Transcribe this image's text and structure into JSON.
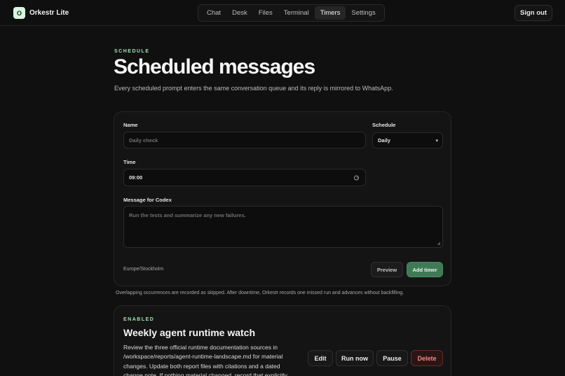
{
  "brand": {
    "mark": "O",
    "name": "Orkestr Lite"
  },
  "nav": {
    "items": [
      "Chat",
      "Desk",
      "Files",
      "Terminal",
      "Timers",
      "Settings"
    ],
    "active": "Timers"
  },
  "header": {
    "signout_label": "Sign out"
  },
  "hero": {
    "eyebrow": "SCHEDULE",
    "title": "Scheduled messages",
    "subtitle": "Every scheduled prompt enters the same conversation queue and its reply is mirrored to WhatsApp."
  },
  "form": {
    "name_label": "Name",
    "name_placeholder": "Daily check",
    "schedule_label": "Schedule",
    "schedule_value": "Daily",
    "time_label": "Time",
    "time_value": "09:00",
    "message_label": "Message for Codex",
    "message_placeholder": "Run the tests and summarize any new failures.",
    "timezone": "Europe/Stockholm",
    "preview_label": "Preview",
    "add_label": "Add timer"
  },
  "note": "Overlapping occurrences are recorded as skipped. After downtime, Orkestr records one missed run and advances without backfilling.",
  "timer": {
    "status": "ENABLED",
    "title": "Weekly agent runtime watch",
    "description": "Review the three official runtime documentation sources in /workspace/reports/agent-runtime-landscape.md for material changes. Update both report files with citations and a dated change note. If nothing material changed, record that explicitly.",
    "edit_label": "Edit",
    "run_label": "Run now",
    "pause_label": "Pause",
    "delete_label": "Delete"
  },
  "colors": {
    "accent": "#9fe3b3",
    "add_button": "#3f7a55",
    "danger": "#f28a8a",
    "background": "#101010"
  }
}
